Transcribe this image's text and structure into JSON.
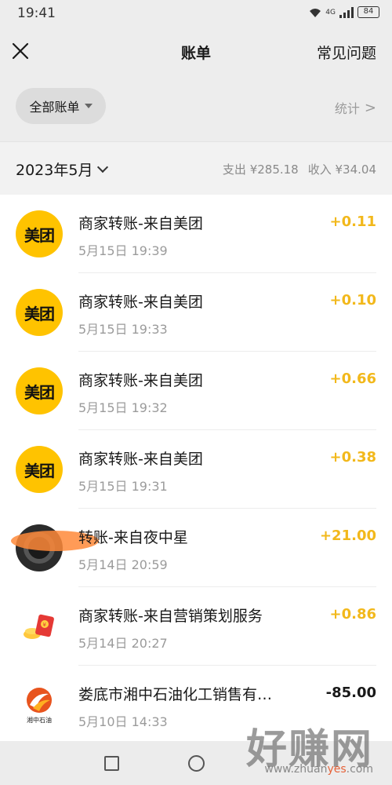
{
  "status_bar": {
    "time": "19:41",
    "network": "4G",
    "battery": "84"
  },
  "nav": {
    "title": "账单",
    "right_label": "常见问题",
    "close_icon": "close-icon"
  },
  "filter": {
    "label": "全部账单",
    "stats_label": "统计",
    "stats_chevron": ">"
  },
  "month_header": {
    "month": "2023年5月",
    "expense": "支出 ¥285.18",
    "income": "收入 ¥34.04"
  },
  "transactions": [
    {
      "avatar": "meituan-logo",
      "avatar_text": "美团",
      "title": "商家转账-来自美团",
      "time": "5月15日 19:39",
      "amount": "+0.11",
      "direction": "in"
    },
    {
      "avatar": "meituan-logo",
      "avatar_text": "美团",
      "title": "商家转账-来自美团",
      "time": "5月15日 19:33",
      "amount": "+0.10",
      "direction": "in"
    },
    {
      "avatar": "meituan-logo",
      "avatar_text": "美团",
      "title": "商家转账-来自美团",
      "time": "5月15日 19:32",
      "amount": "+0.66",
      "direction": "in"
    },
    {
      "avatar": "meituan-logo",
      "avatar_text": "美团",
      "title": "商家转账-来自美团",
      "time": "5月15日 19:31",
      "amount": "+0.38",
      "direction": "in"
    },
    {
      "avatar": "person-avatar",
      "avatar_text": "",
      "title": "转账-来自夜中星",
      "time": "5月14日 20:59",
      "amount": "+21.00",
      "direction": "in"
    },
    {
      "avatar": "red-packet-icon",
      "avatar_text": "",
      "title": "商家转账-来自营销策划服务",
      "time": "5月14日 20:27",
      "amount": "+0.86",
      "direction": "in"
    },
    {
      "avatar": "petroleum-logo",
      "avatar_text": "湘中石油",
      "title": "娄底市湘中石油化工销售有…",
      "time": "5月10日 14:33",
      "amount": "-85.00",
      "direction": "out"
    }
  ],
  "colors": {
    "income": "#f2b81b",
    "meituan_yellow": "#ffc300",
    "background": "#ededed"
  },
  "watermark": {
    "big": "好赚网",
    "small_prefix": "www.zhuan",
    "small_highlight": "yes",
    "small_suffix": ".com"
  }
}
